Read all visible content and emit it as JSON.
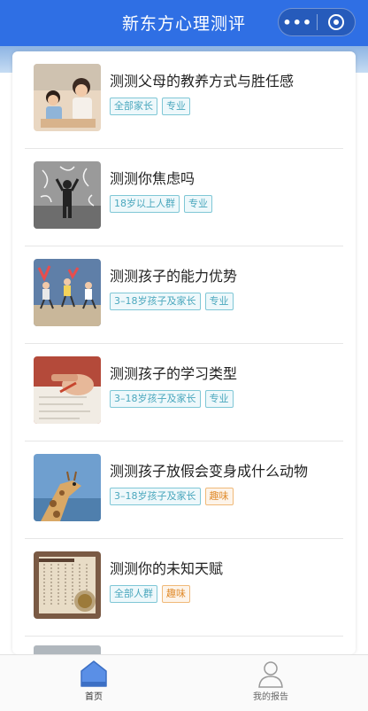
{
  "header": {
    "title": "新东方心理测评",
    "more_label": "•••"
  },
  "items": [
    {
      "title": "测测父母的教养方式与胜任感",
      "tags": [
        {
          "label": "全部家长",
          "kind": "pro"
        },
        {
          "label": "专业",
          "kind": "pro"
        }
      ],
      "image": "parent-child-photo"
    },
    {
      "title": "测测你焦虑吗",
      "tags": [
        {
          "label": "18岁以上人群",
          "kind": "pro"
        },
        {
          "label": "专业",
          "kind": "pro"
        }
      ],
      "image": "anxious-man-photo"
    },
    {
      "title": "测测孩子的能力优势",
      "tags": [
        {
          "label": "3–18岁孩子及家长",
          "kind": "pro"
        },
        {
          "label": "专业",
          "kind": "pro"
        }
      ],
      "image": "kids-jumping-photo"
    },
    {
      "title": "测测孩子的学习类型",
      "tags": [
        {
          "label": "3–18岁孩子及家长",
          "kind": "pro"
        },
        {
          "label": "专业",
          "kind": "pro"
        }
      ],
      "image": "child-writing-photo"
    },
    {
      "title": "测测孩子放假会变身成什么动物",
      "tags": [
        {
          "label": "3–18岁孩子及家长",
          "kind": "pro"
        },
        {
          "label": "趣味",
          "kind": "fun"
        }
      ],
      "image": "giraffe-photo"
    },
    {
      "title": "测测你的未知天赋",
      "tags": [
        {
          "label": "全部人群",
          "kind": "pro"
        },
        {
          "label": "趣味",
          "kind": "fun"
        }
      ],
      "image": "book-tea-photo"
    }
  ],
  "tabbar": [
    {
      "label": "首页",
      "icon": "home-icon",
      "active": true
    },
    {
      "label": "我的报告",
      "icon": "person-icon",
      "active": false
    }
  ],
  "colors": {
    "header": "#2f6fe4",
    "tag_pro": "#4aa7bd",
    "tag_fun": "#e08a2a",
    "tab_active_icon": "#5a8fe6"
  }
}
